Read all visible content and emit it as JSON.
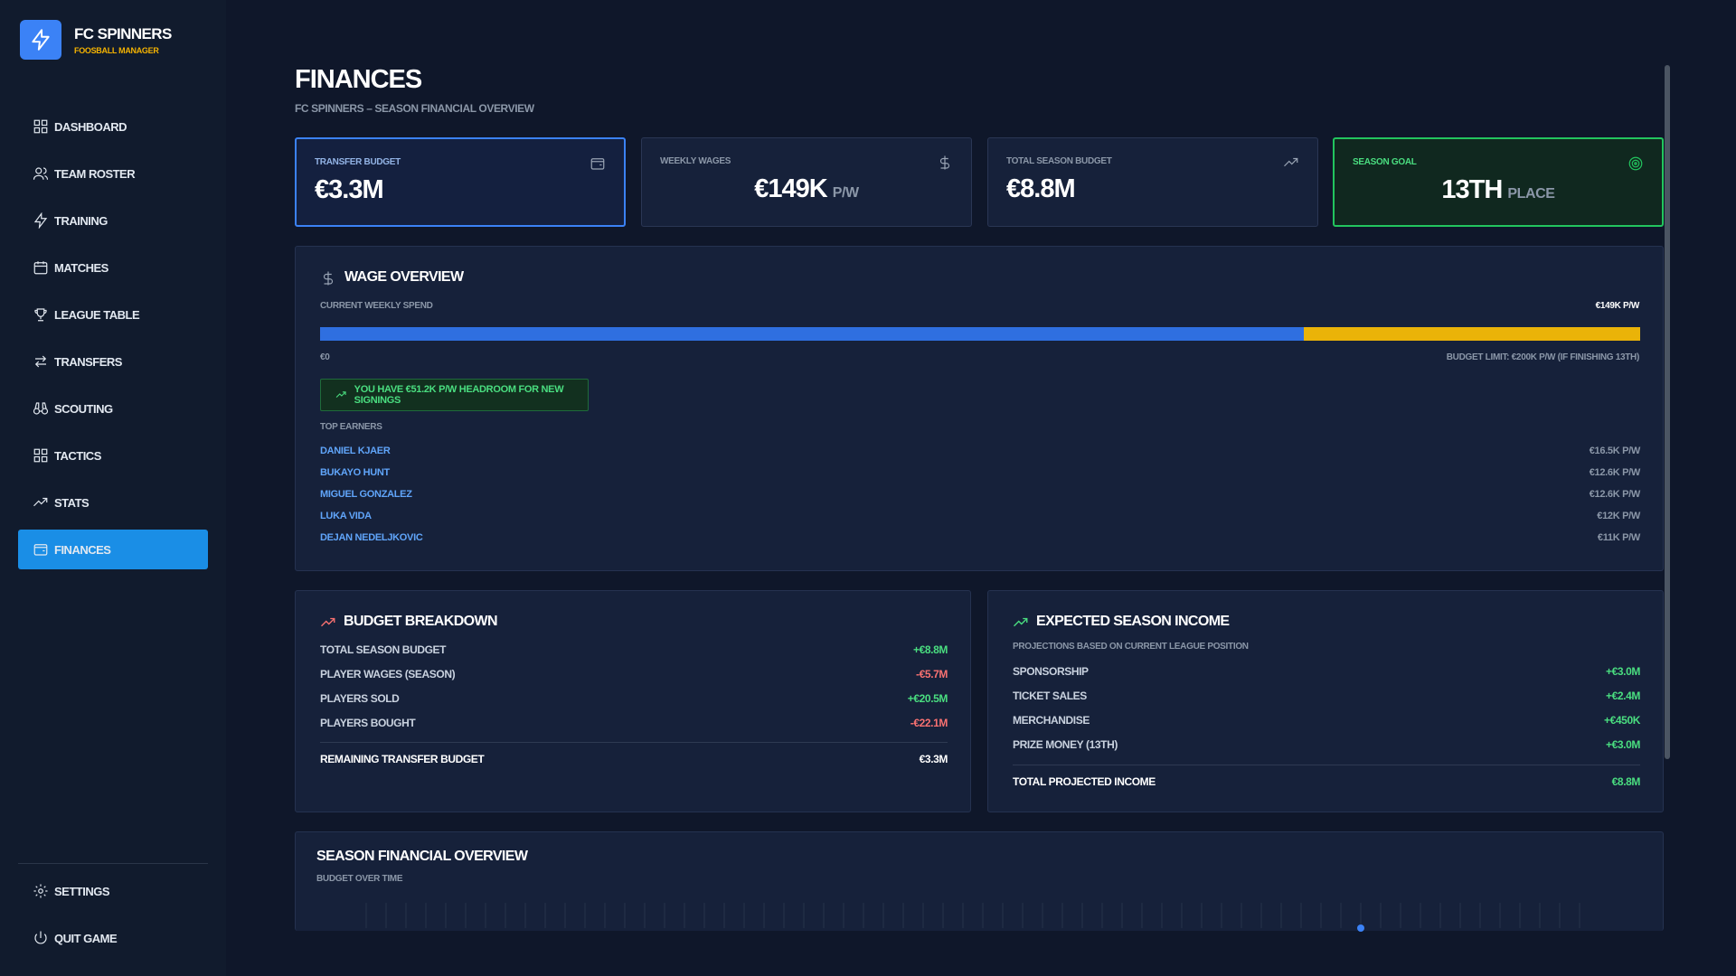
{
  "app": {
    "name": "FC SPINNERS",
    "subtitle": "FOOSBALL MANAGER"
  },
  "nav": {
    "items": [
      {
        "label": "DASHBOARD",
        "icon": "grid-icon"
      },
      {
        "label": "TEAM ROSTER",
        "icon": "users-icon"
      },
      {
        "label": "TRAINING",
        "icon": "bolt-icon"
      },
      {
        "label": "MATCHES",
        "icon": "calendar-icon"
      },
      {
        "label": "LEAGUE TABLE",
        "icon": "trophy-icon"
      },
      {
        "label": "TRANSFERS",
        "icon": "arrows-icon"
      },
      {
        "label": "SCOUTING",
        "icon": "binoculars-icon"
      },
      {
        "label": "TACTICS",
        "icon": "grid-icon"
      },
      {
        "label": "STATS",
        "icon": "trend-icon"
      },
      {
        "label": "FINANCES",
        "icon": "wallet-icon",
        "active": true
      }
    ],
    "bottom": [
      {
        "label": "SETTINGS",
        "icon": "gear-icon"
      },
      {
        "label": "QUIT GAME",
        "icon": "power-icon"
      }
    ]
  },
  "page": {
    "title": "FINANCES",
    "subtitle": "FC SPINNERS – SEASON FINANCIAL OVERVIEW"
  },
  "stats": {
    "transfer_budget": {
      "label": "TRANSFER BUDGET",
      "value": "€3.3M"
    },
    "weekly_wages": {
      "label": "WEEKLY WAGES",
      "value": "€149K",
      "unit": "P/W"
    },
    "total_season_budget": {
      "label": "TOTAL SEASON BUDGET",
      "value": "€8.8M"
    },
    "season_goal": {
      "label": "SEASON GOAL",
      "value": "13TH",
      "unit": "PLACE"
    }
  },
  "wage_overview": {
    "title": "WAGE OVERVIEW",
    "current_label": "CURRENT WEEKLY SPEND",
    "current_value": "€149K P/W",
    "spend_fraction": 0.745,
    "min_label": "€0",
    "limit_label": "BUDGET LIMIT: €200K P/W (IF FINISHING 13TH)",
    "headroom_text": "YOU HAVE €51.2K P/W HEADROOM FOR NEW SIGNINGS",
    "top_earners_label": "TOP EARNERS",
    "top_earners": [
      {
        "name": "DANIEL KJAER",
        "wage": "€16.5K P/W"
      },
      {
        "name": "BUKAYO HUNT",
        "wage": "€12.6K P/W"
      },
      {
        "name": "MIGUEL GONZALEZ",
        "wage": "€12.6K P/W"
      },
      {
        "name": "LUKA VIDA",
        "wage": "€12K P/W"
      },
      {
        "name": "DEJAN NEDELJKOVIC",
        "wage": "€11K P/W"
      }
    ]
  },
  "budget_breakdown": {
    "title": "BUDGET BREAKDOWN",
    "rows": [
      {
        "label": "TOTAL SEASON BUDGET",
        "value": "+€8.8M",
        "sign": "pos"
      },
      {
        "label": "PLAYER WAGES (SEASON)",
        "value": "-€5.7M",
        "sign": "neg"
      },
      {
        "label": "PLAYERS SOLD",
        "value": "+€20.5M",
        "sign": "pos"
      },
      {
        "label": "PLAYERS BOUGHT",
        "value": "-€22.1M",
        "sign": "neg"
      }
    ],
    "total_label": "REMAINING TRANSFER BUDGET",
    "total_value": "€3.3M"
  },
  "expected_income": {
    "title": "EXPECTED SEASON INCOME",
    "subtitle": "PROJECTIONS BASED ON CURRENT LEAGUE POSITION",
    "rows": [
      {
        "label": "SPONSORSHIP",
        "value": "+€3.0M"
      },
      {
        "label": "TICKET SALES",
        "value": "+€2.4M"
      },
      {
        "label": "MERCHANDISE",
        "value": "+€450K"
      },
      {
        "label": "PRIZE MONEY (13TH)",
        "value": "+€3.0M"
      }
    ],
    "total_label": "TOTAL PROJECTED INCOME",
    "total_value": "€8.8M"
  },
  "season_overview": {
    "title": "SEASON FINANCIAL OVERVIEW",
    "subtitle": "BUDGET OVER TIME"
  },
  "colors": {
    "accent": "#3b82f6",
    "active_nav": "#1a8ee6",
    "gold": "#f5b301",
    "positive": "#4ade80",
    "negative": "#f87171",
    "wage_bar": "#2f6fe0",
    "limit_bar": "#eab308"
  }
}
